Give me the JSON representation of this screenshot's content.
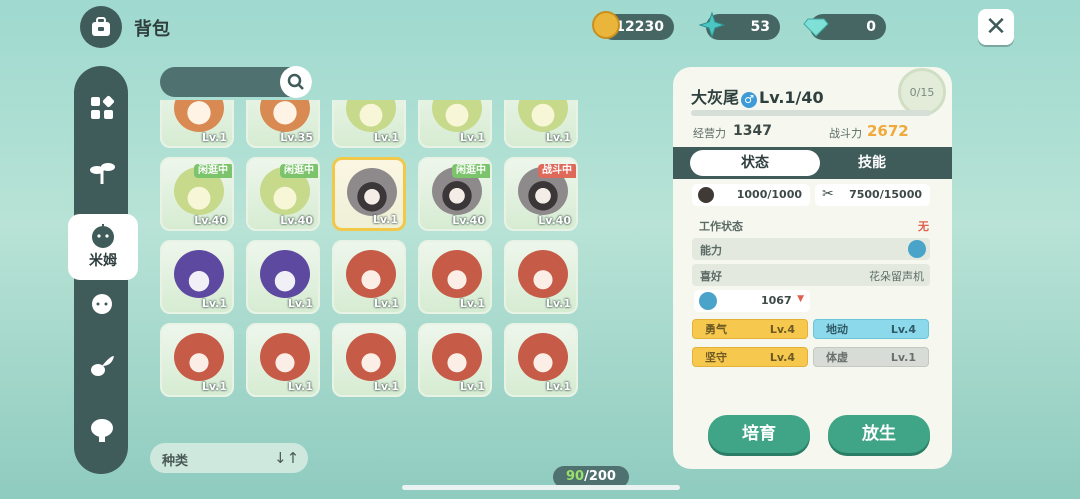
{
  "header": {
    "title": "背包"
  },
  "resources": [
    {
      "icon": "gold-coin-icon",
      "value": "12230"
    },
    {
      "icon": "star-crystal-icon",
      "value": "53"
    },
    {
      "icon": "diamond-icon",
      "value": "0"
    }
  ],
  "nav": {
    "active_label": "米姆"
  },
  "grid": {
    "rows": [
      [
        {
          "pet": "fox",
          "lv": "Lv.1"
        },
        {
          "pet": "fox",
          "lv": "Lv.35"
        },
        {
          "pet": "cat",
          "lv": "Lv.1"
        },
        {
          "pet": "cat",
          "lv": "Lv.1"
        },
        {
          "pet": "cat",
          "lv": "Lv.1"
        }
      ],
      [
        {
          "pet": "cat",
          "lv": "Lv.40",
          "tag": "闲逛中"
        },
        {
          "pet": "cat",
          "lv": "Lv.40",
          "tag": "闲逛中"
        },
        {
          "pet": "rac",
          "lv": "Lv.1",
          "selected": true
        },
        {
          "pet": "rac",
          "lv": "Lv.40",
          "tag": "闲逛中"
        },
        {
          "pet": "rac",
          "lv": "Lv.40",
          "tag": "战斗中"
        }
      ],
      [
        {
          "pet": "pur",
          "lv": "Lv.1"
        },
        {
          "pet": "pur",
          "lv": "Lv.1"
        },
        {
          "pet": "red",
          "lv": "Lv.1"
        },
        {
          "pet": "red",
          "lv": "Lv.1"
        },
        {
          "pet": "red",
          "lv": "Lv.1"
        }
      ],
      [
        {
          "pet": "red",
          "lv": "Lv.1"
        },
        {
          "pet": "red",
          "lv": "Lv.1"
        },
        {
          "pet": "red",
          "lv": "Lv.1"
        },
        {
          "pet": "red",
          "lv": "Lv.1"
        },
        {
          "pet": "red",
          "lv": "Lv.1"
        }
      ]
    ]
  },
  "sort": {
    "label": "种类",
    "icon": "↓↑"
  },
  "counter": {
    "current": "90",
    "max": "/200"
  },
  "detail": {
    "name": "大灰尾",
    "gender": "♂",
    "level": "Lv.1/40",
    "exp_badge": "0/15",
    "exp_progress": 0,
    "management_label": "经营力",
    "management_value": "1347",
    "combat_label": "战斗力",
    "combat_value": "2672",
    "tab_status": "状态",
    "tab_skills": "技能",
    "hunger": "1000/1000",
    "stamina": "7500/15000",
    "work_label": "工作状态",
    "work_value": "无",
    "ability_label": "能力",
    "preference_label": "喜好",
    "preference_value": "花朵留声机",
    "affinity": "1067",
    "skills": [
      {
        "name": "勇气",
        "lv": "Lv.4",
        "color": "yellow"
      },
      {
        "name": "地动",
        "lv": "Lv.4",
        "color": "blue"
      },
      {
        "name": "坚守",
        "lv": "Lv.4",
        "color": "yellow"
      },
      {
        "name": "体虚",
        "lv": "Lv.1",
        "color": "gray"
      }
    ],
    "btn_train": "培育",
    "btn_release": "放生"
  }
}
